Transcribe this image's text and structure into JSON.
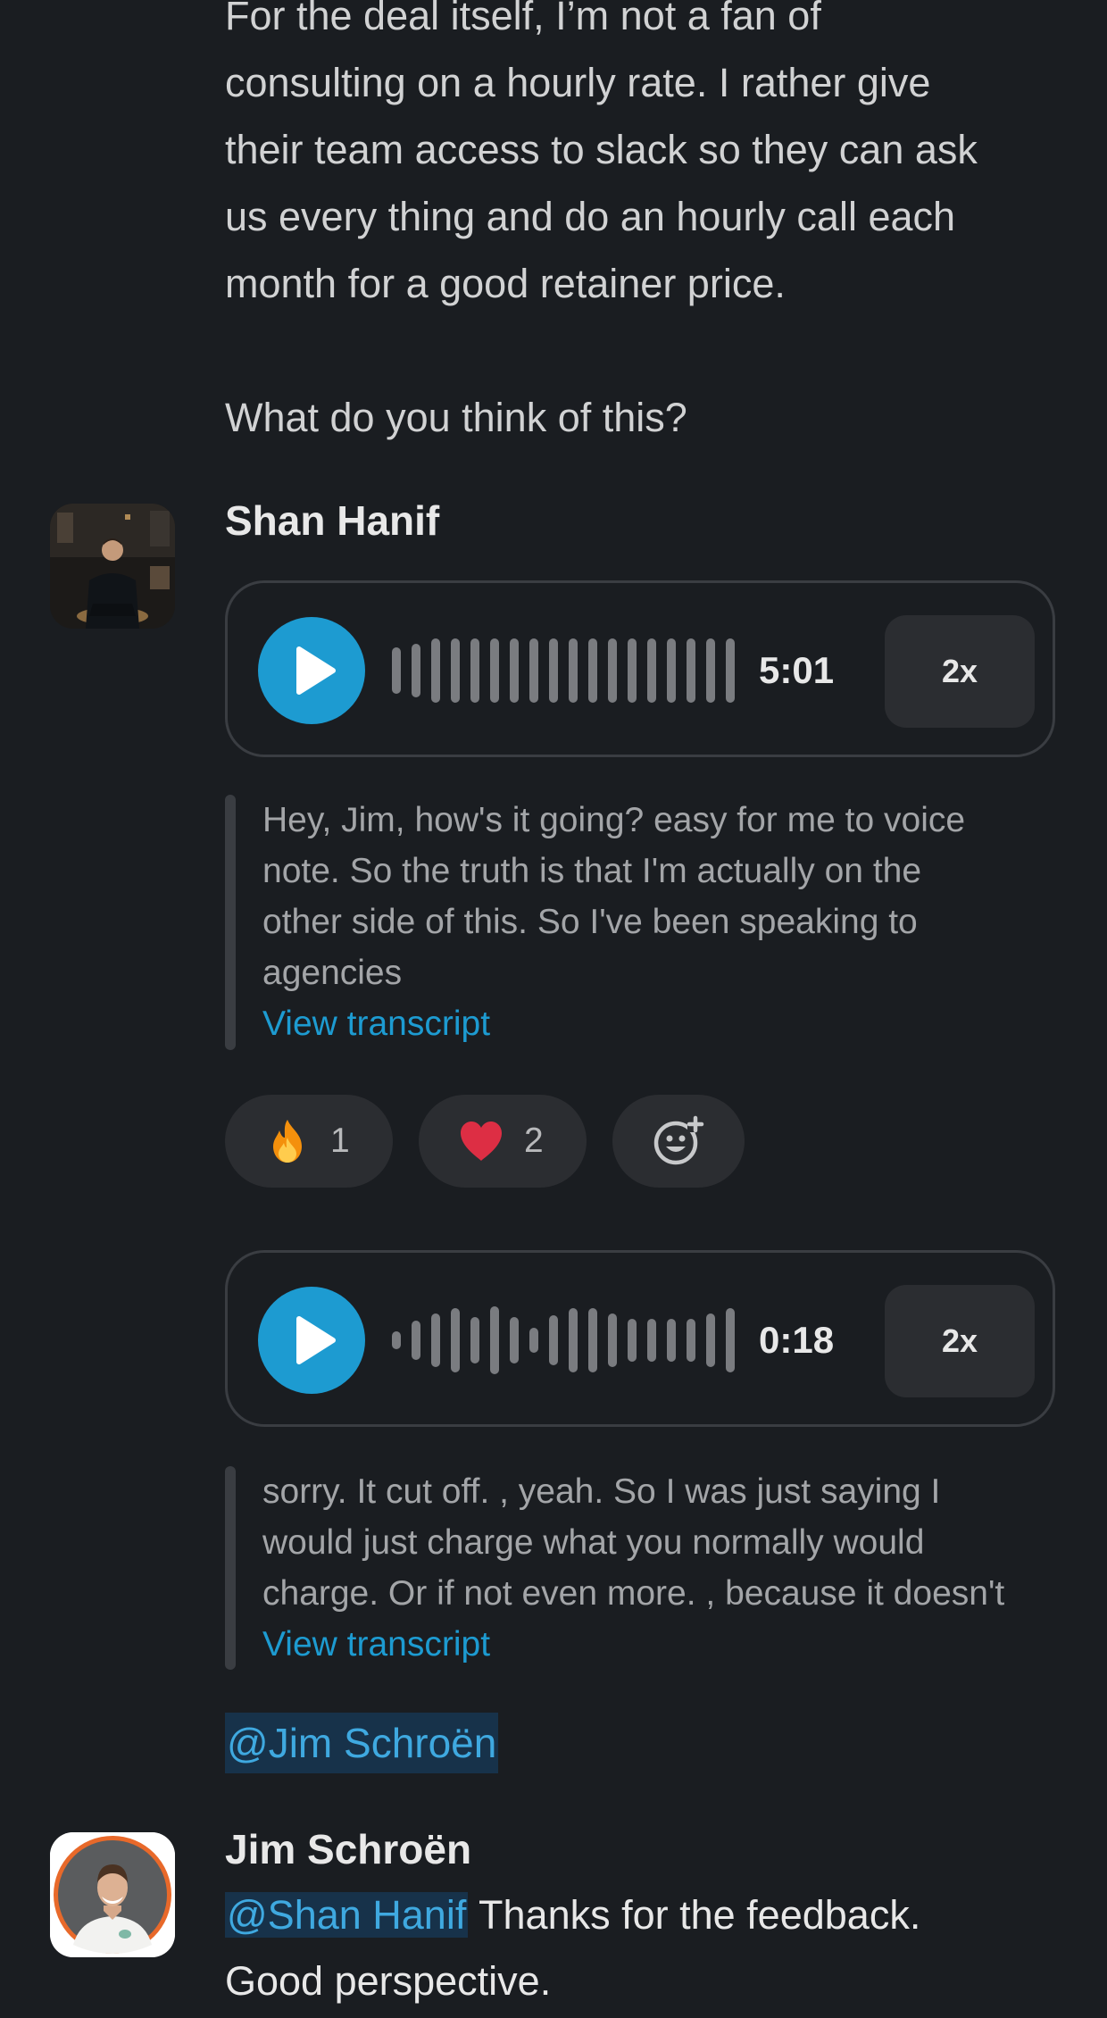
{
  "previous_message": {
    "lines": [
      "For the deal itself, I’m not a fan of",
      "consulting on a hourly rate. I rather give",
      "their team access to slack so they can ask",
      "us every thing and do an hourly call each",
      "month for a good retainer price."
    ],
    "question": "What do you think of this?"
  },
  "shan_message": {
    "author": "Shan Hanif",
    "voice_notes": [
      {
        "duration": "5:01",
        "speed": "2x",
        "transcript_lines": [
          "Hey, Jim, how's it going? easy for me to voice",
          "note. So the truth is that I'm actually on the",
          "other side of this. So I've been speaking to",
          "agencies"
        ],
        "view_transcript": "View transcript"
      },
      {
        "duration": "0:18",
        "speed": "2x",
        "transcript_lines": [
          "sorry. It cut off. , yeah. So I was just saying I",
          "would just charge what you normally would",
          "charge. Or if not even more. , because it doesn't"
        ],
        "view_transcript": "View transcript"
      }
    ],
    "reactions": [
      {
        "emoji": "fire-emoji",
        "count": "1"
      },
      {
        "emoji": "heart-emoji",
        "count": "2"
      }
    ],
    "add_reaction_icon": "add-reaction-icon",
    "mention": "@Jim Schroën"
  },
  "jim_message": {
    "author": "Jim Schroën",
    "mention": "@Shan Hanif",
    "text_line1": " Thanks for the feedback.",
    "text_line2": "Good perspective."
  },
  "colors": {
    "background": "#1a1d21",
    "accent": "#1d9bd1",
    "mention_bg": "#17324a",
    "mention_text": "#3fa9e0"
  }
}
